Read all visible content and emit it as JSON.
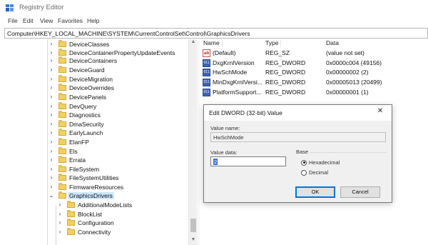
{
  "window": {
    "title": "Registry Editor"
  },
  "menu": [
    "File",
    "Edit",
    "View",
    "Favorites",
    "Help"
  ],
  "address": "Computer\\HKEY_LOCAL_MACHINE\\SYSTEM\\CurrentControlSet\\Control\\GraphicsDrivers",
  "tree": {
    "items": [
      {
        "label": "DeviceClasses",
        "expander": "›"
      },
      {
        "label": "DeviceContainerPropertyUpdateEvents",
        "expander": "›"
      },
      {
        "label": "DeviceContainers",
        "expander": "›"
      },
      {
        "label": "DeviceGuard",
        "expander": "›"
      },
      {
        "label": "DeviceMigration",
        "expander": "›"
      },
      {
        "label": "DeviceOverrides",
        "expander": "›"
      },
      {
        "label": "DevicePanels",
        "expander": "›"
      },
      {
        "label": "DevQuery",
        "expander": "›"
      },
      {
        "label": "Diagnostics",
        "expander": "›"
      },
      {
        "label": "DmaSecurity",
        "expander": "›"
      },
      {
        "label": "EarlyLaunch",
        "expander": "›"
      },
      {
        "label": "ElanFP",
        "expander": "›"
      },
      {
        "label": "Els",
        "expander": "›"
      },
      {
        "label": "Errata",
        "expander": "›"
      },
      {
        "label": "FileSystem",
        "expander": "›"
      },
      {
        "label": "FileSystemUtilities",
        "expander": "›"
      },
      {
        "label": "FirmwareResources",
        "expander": "›"
      },
      {
        "label": "GraphicsDrivers",
        "expander": "⌄"
      },
      {
        "label": "AdditionalModeLists",
        "expander": "›"
      },
      {
        "label": "BlockList",
        "expander": "›"
      },
      {
        "label": "Configuration",
        "expander": "›"
      },
      {
        "label": "Connectivity",
        "expander": "›"
      }
    ]
  },
  "values_pane": {
    "columns": [
      "Name",
      "Type",
      "Data"
    ],
    "rows": [
      {
        "name": "(Default)",
        "type": "REG_SZ",
        "data": "(value not set)",
        "icon": "string-value-icon",
        "icon_text": "ab"
      },
      {
        "name": "DxgKrnlVersion",
        "type": "REG_DWORD",
        "data": "0x0000c004 (49156)",
        "icon": "binary-value-icon",
        "icon_text": "011"
      },
      {
        "name": "HwSchMode",
        "type": "REG_DWORD",
        "data": "0x00000002 (2)",
        "icon": "binary-value-icon",
        "icon_text": "011"
      },
      {
        "name": "MinDxgKrnlVersi...",
        "type": "REG_DWORD",
        "data": "0x00005013 (20499)",
        "icon": "binary-value-icon",
        "icon_text": "011"
      },
      {
        "name": "PlatformSupport...",
        "type": "REG_DWORD",
        "data": "0x00000001 (1)",
        "icon": "binary-value-icon",
        "icon_text": "011"
      }
    ]
  },
  "dialog": {
    "title": "Edit DWORD (32-bit) Value",
    "close_glyph": "✕",
    "value_name_label": "Value name:",
    "value_name": "HwSchMode",
    "value_data_label": "Value data:",
    "value_data": "2",
    "base_label": "Base",
    "base_options": [
      "Hexadecimal",
      "Decimal"
    ],
    "base_selected": "Hexadecimal",
    "ok_label": "OK",
    "cancel_label": "Cancel"
  },
  "colors": {
    "selection": "#cce8ff",
    "folder": "#f3cf62",
    "default_button_border": "#0078d7"
  }
}
